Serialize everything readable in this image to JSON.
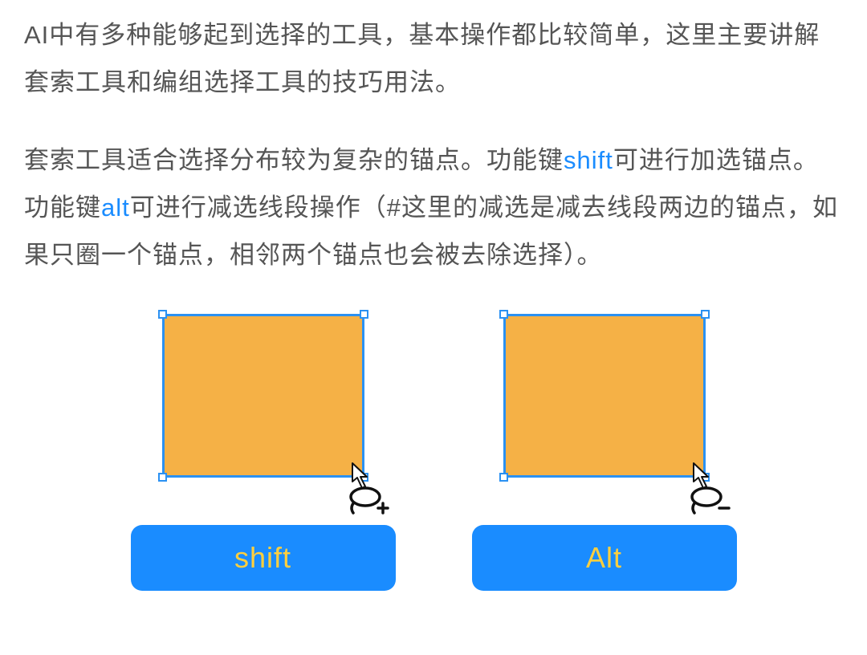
{
  "para1": "AI中有多种能够起到选择的工具，基本操作都比较简单，这里主要讲解套索工具和编组选择工具的技巧用法。",
  "para2_a": "套索工具适合选择分布较为复杂的锚点。功能键",
  "para2_hl1": "shift",
  "para2_b": "可进行加选锚点。功能键",
  "para2_hl2": "alt",
  "para2_c": "可进行减选线段操作（#这里的减选是减去线段两边的锚点，如果只圈一个锚点，相邻两个锚点也会被去除选择）。",
  "keys": {
    "shift": "shift",
    "alt": "Alt"
  },
  "colors": {
    "accent": "#1a8cff",
    "fill": "#f5b146",
    "keytext": "#ffcf3e"
  }
}
